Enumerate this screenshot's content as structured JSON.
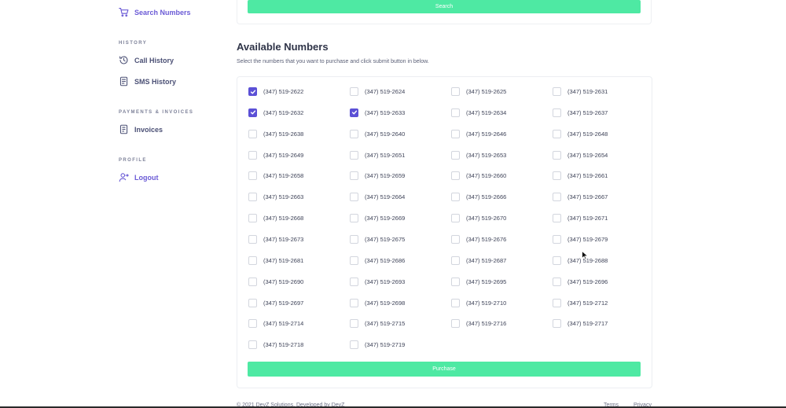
{
  "sidebar": {
    "search_numbers": "Search Numbers",
    "history_label": "HISTORY",
    "call_history": "Call History",
    "sms_history": "SMS History",
    "payments_label": "PAYMENTS & INVOICES",
    "invoices": "Invoices",
    "profile_label": "PROFILE",
    "logout": "Logout",
    "accent_color": "#6b5bd6"
  },
  "search_button": "Search",
  "main": {
    "title": "Available Numbers",
    "subtitle": "Select the numbers that you want to purchase and click submit button in below.",
    "purchase_button": "Purchase",
    "button_color": "#4ee9a3",
    "checkbox_color": "#5b50d6",
    "numbers": [
      {
        "number": "(347) 519-2622",
        "checked": true
      },
      {
        "number": "(347) 519-2624",
        "checked": false
      },
      {
        "number": "(347) 519-2625",
        "checked": false
      },
      {
        "number": "(347) 519-2631",
        "checked": false
      },
      {
        "number": "(347) 519-2632",
        "checked": true
      },
      {
        "number": "(347) 519-2633",
        "checked": true
      },
      {
        "number": "(347) 519-2634",
        "checked": false
      },
      {
        "number": "(347) 519-2637",
        "checked": false
      },
      {
        "number": "(347) 519-2638",
        "checked": false
      },
      {
        "number": "(347) 519-2640",
        "checked": false
      },
      {
        "number": "(347) 519-2646",
        "checked": false
      },
      {
        "number": "(347) 519-2648",
        "checked": false
      },
      {
        "number": "(347) 519-2649",
        "checked": false
      },
      {
        "number": "(347) 519-2651",
        "checked": false
      },
      {
        "number": "(347) 519-2653",
        "checked": false
      },
      {
        "number": "(347) 519-2654",
        "checked": false
      },
      {
        "number": "(347) 519-2658",
        "checked": false
      },
      {
        "number": "(347) 519-2659",
        "checked": false
      },
      {
        "number": "(347) 519-2660",
        "checked": false
      },
      {
        "number": "(347) 519-2661",
        "checked": false
      },
      {
        "number": "(347) 519-2663",
        "checked": false
      },
      {
        "number": "(347) 519-2664",
        "checked": false
      },
      {
        "number": "(347) 519-2666",
        "checked": false
      },
      {
        "number": "(347) 519-2667",
        "checked": false
      },
      {
        "number": "(347) 519-2668",
        "checked": false
      },
      {
        "number": "(347) 519-2669",
        "checked": false
      },
      {
        "number": "(347) 519-2670",
        "checked": false
      },
      {
        "number": "(347) 519-2671",
        "checked": false
      },
      {
        "number": "(347) 519-2673",
        "checked": false
      },
      {
        "number": "(347) 519-2675",
        "checked": false
      },
      {
        "number": "(347) 519-2676",
        "checked": false
      },
      {
        "number": "(347) 519-2679",
        "checked": false
      },
      {
        "number": "(347) 519-2681",
        "checked": false
      },
      {
        "number": "(347) 519-2686",
        "checked": false
      },
      {
        "number": "(347) 519-2687",
        "checked": false
      },
      {
        "number": "(347) 519-2688",
        "checked": false
      },
      {
        "number": "(347) 519-2690",
        "checked": false
      },
      {
        "number": "(347) 519-2693",
        "checked": false
      },
      {
        "number": "(347) 519-2695",
        "checked": false
      },
      {
        "number": "(347) 519-2696",
        "checked": false
      },
      {
        "number": "(347) 519-2697",
        "checked": false
      },
      {
        "number": "(347) 519-2698",
        "checked": false
      },
      {
        "number": "(347) 519-2710",
        "checked": false
      },
      {
        "number": "(347) 519-2712",
        "checked": false
      },
      {
        "number": "(347) 519-2714",
        "checked": false
      },
      {
        "number": "(347) 519-2715",
        "checked": false
      },
      {
        "number": "(347) 519-2716",
        "checked": false
      },
      {
        "number": "(347) 519-2717",
        "checked": false
      },
      {
        "number": "(347) 519-2718",
        "checked": false
      },
      {
        "number": "(347) 519-2719",
        "checked": false
      }
    ]
  },
  "footer": {
    "copyright": "© 2021 DevZ Solutions. Developed by DevZ",
    "terms": "Terms",
    "privacy": "Privacy"
  }
}
